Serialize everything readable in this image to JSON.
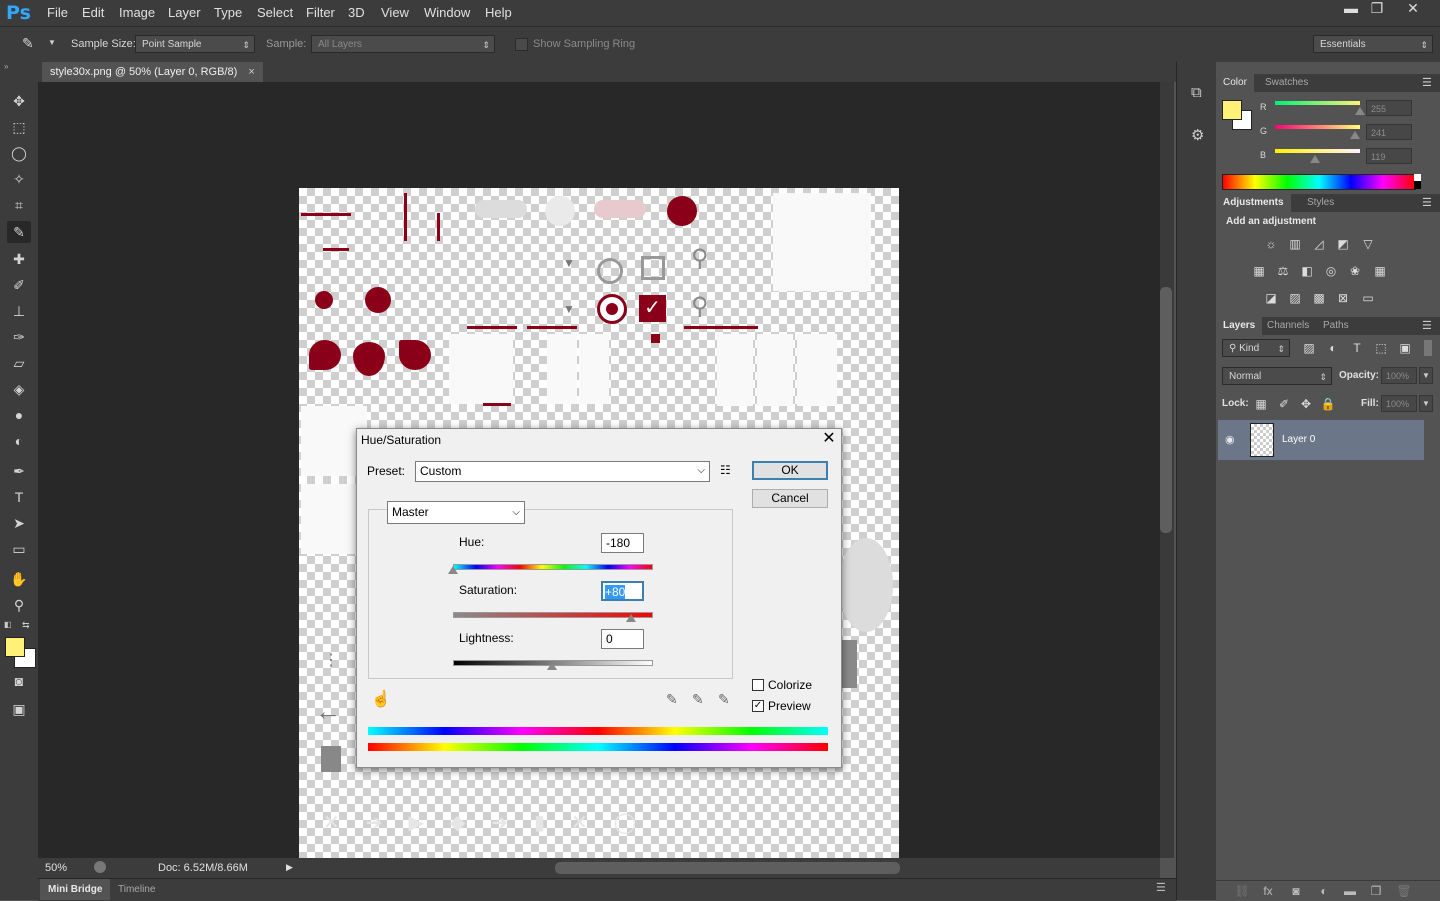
{
  "app": {
    "logo": "Ps"
  },
  "menu": [
    "File",
    "Edit",
    "Image",
    "Layer",
    "Type",
    "Select",
    "Filter",
    "3D",
    "View",
    "Window",
    "Help"
  ],
  "window_controls": {
    "minimize": "▬",
    "restore": "❐",
    "close": "✕"
  },
  "options_bar": {
    "sample_size_label": "Sample Size:",
    "sample_size_value": "Point Sample",
    "sample_label": "Sample:",
    "sample_value": "All Layers",
    "sampling_ring_label": "Show Sampling Ring",
    "workspace": "Essentials"
  },
  "document": {
    "tab_title": "style30x.png @ 50% (Layer 0, RGB/8)",
    "close_glyph": "×",
    "zoom": "50%",
    "doc_info": "Doc: 6.52M/8.66M"
  },
  "bottom_tabs": [
    "Mini Bridge",
    "Timeline"
  ],
  "color_panel": {
    "tabs": [
      "Color",
      "Swatches"
    ],
    "foreground": "#fff177",
    "background": "#ffffff",
    "channels": [
      {
        "label": "R",
        "value": "255",
        "level": 1.0
      },
      {
        "label": "G",
        "value": "241",
        "level": 0.945
      },
      {
        "label": "B",
        "value": "119",
        "level": 0.467
      }
    ]
  },
  "adjustments_panel": {
    "tabs": [
      "Adjustments",
      "Styles"
    ],
    "prompt": "Add an adjustment"
  },
  "layers_panel": {
    "tabs": [
      "Layers",
      "Channels",
      "Paths"
    ],
    "filter_kind": "Kind",
    "blend_mode": "Normal",
    "opacity_label": "Opacity:",
    "opacity_value": "100%",
    "lock_label": "Lock:",
    "fill_label": "Fill:",
    "fill_value": "100%",
    "layers": [
      {
        "name": "Layer 0",
        "visible": true
      }
    ]
  },
  "dialog": {
    "title": "Hue/Saturation",
    "preset_label": "Preset:",
    "preset_value": "Custom",
    "ok": "OK",
    "cancel": "Cancel",
    "channel": "Master",
    "hue_label": "Hue:",
    "hue_value": "-180",
    "hue_level": 0.0,
    "saturation_label": "Saturation:",
    "saturation_value": "+80",
    "saturation_level": 0.9,
    "lightness_label": "Lightness:",
    "lightness_value": "0",
    "lightness_level": 0.5,
    "colorize_label": "Colorize",
    "colorize_checked": false,
    "preview_label": "Preview",
    "preview_checked": true
  }
}
